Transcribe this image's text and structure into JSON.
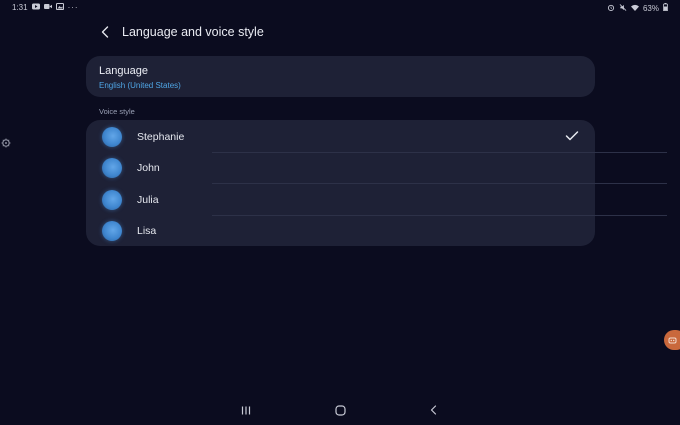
{
  "status_bar": {
    "time": "1:31",
    "overflow": "···",
    "battery_percent": "63%",
    "left_icons": [
      "youtube-icon",
      "video-icon",
      "gallery-icon"
    ],
    "right_icons": [
      "alarm-icon",
      "mute-icon",
      "wifi-icon",
      "battery-icon"
    ]
  },
  "header": {
    "title": "Language and voice style",
    "back_icon": "chevron-left-icon"
  },
  "language": {
    "label": "Language",
    "value": "English (United States)"
  },
  "voice_style": {
    "section_label": "Voice style",
    "selected_index": 0,
    "items": [
      {
        "name": "Stephanie"
      },
      {
        "name": "John"
      },
      {
        "name": "Julia"
      },
      {
        "name": "Lisa"
      }
    ]
  },
  "nav_bar": {
    "buttons": [
      "recents-icon",
      "home-icon",
      "back-icon"
    ]
  },
  "colors": {
    "background": "#0b0c1f",
    "card": "#1e2136",
    "accent_link": "#4fa6e6",
    "avatar": "#3f86cf",
    "floating_bubble": "#c9683c"
  }
}
